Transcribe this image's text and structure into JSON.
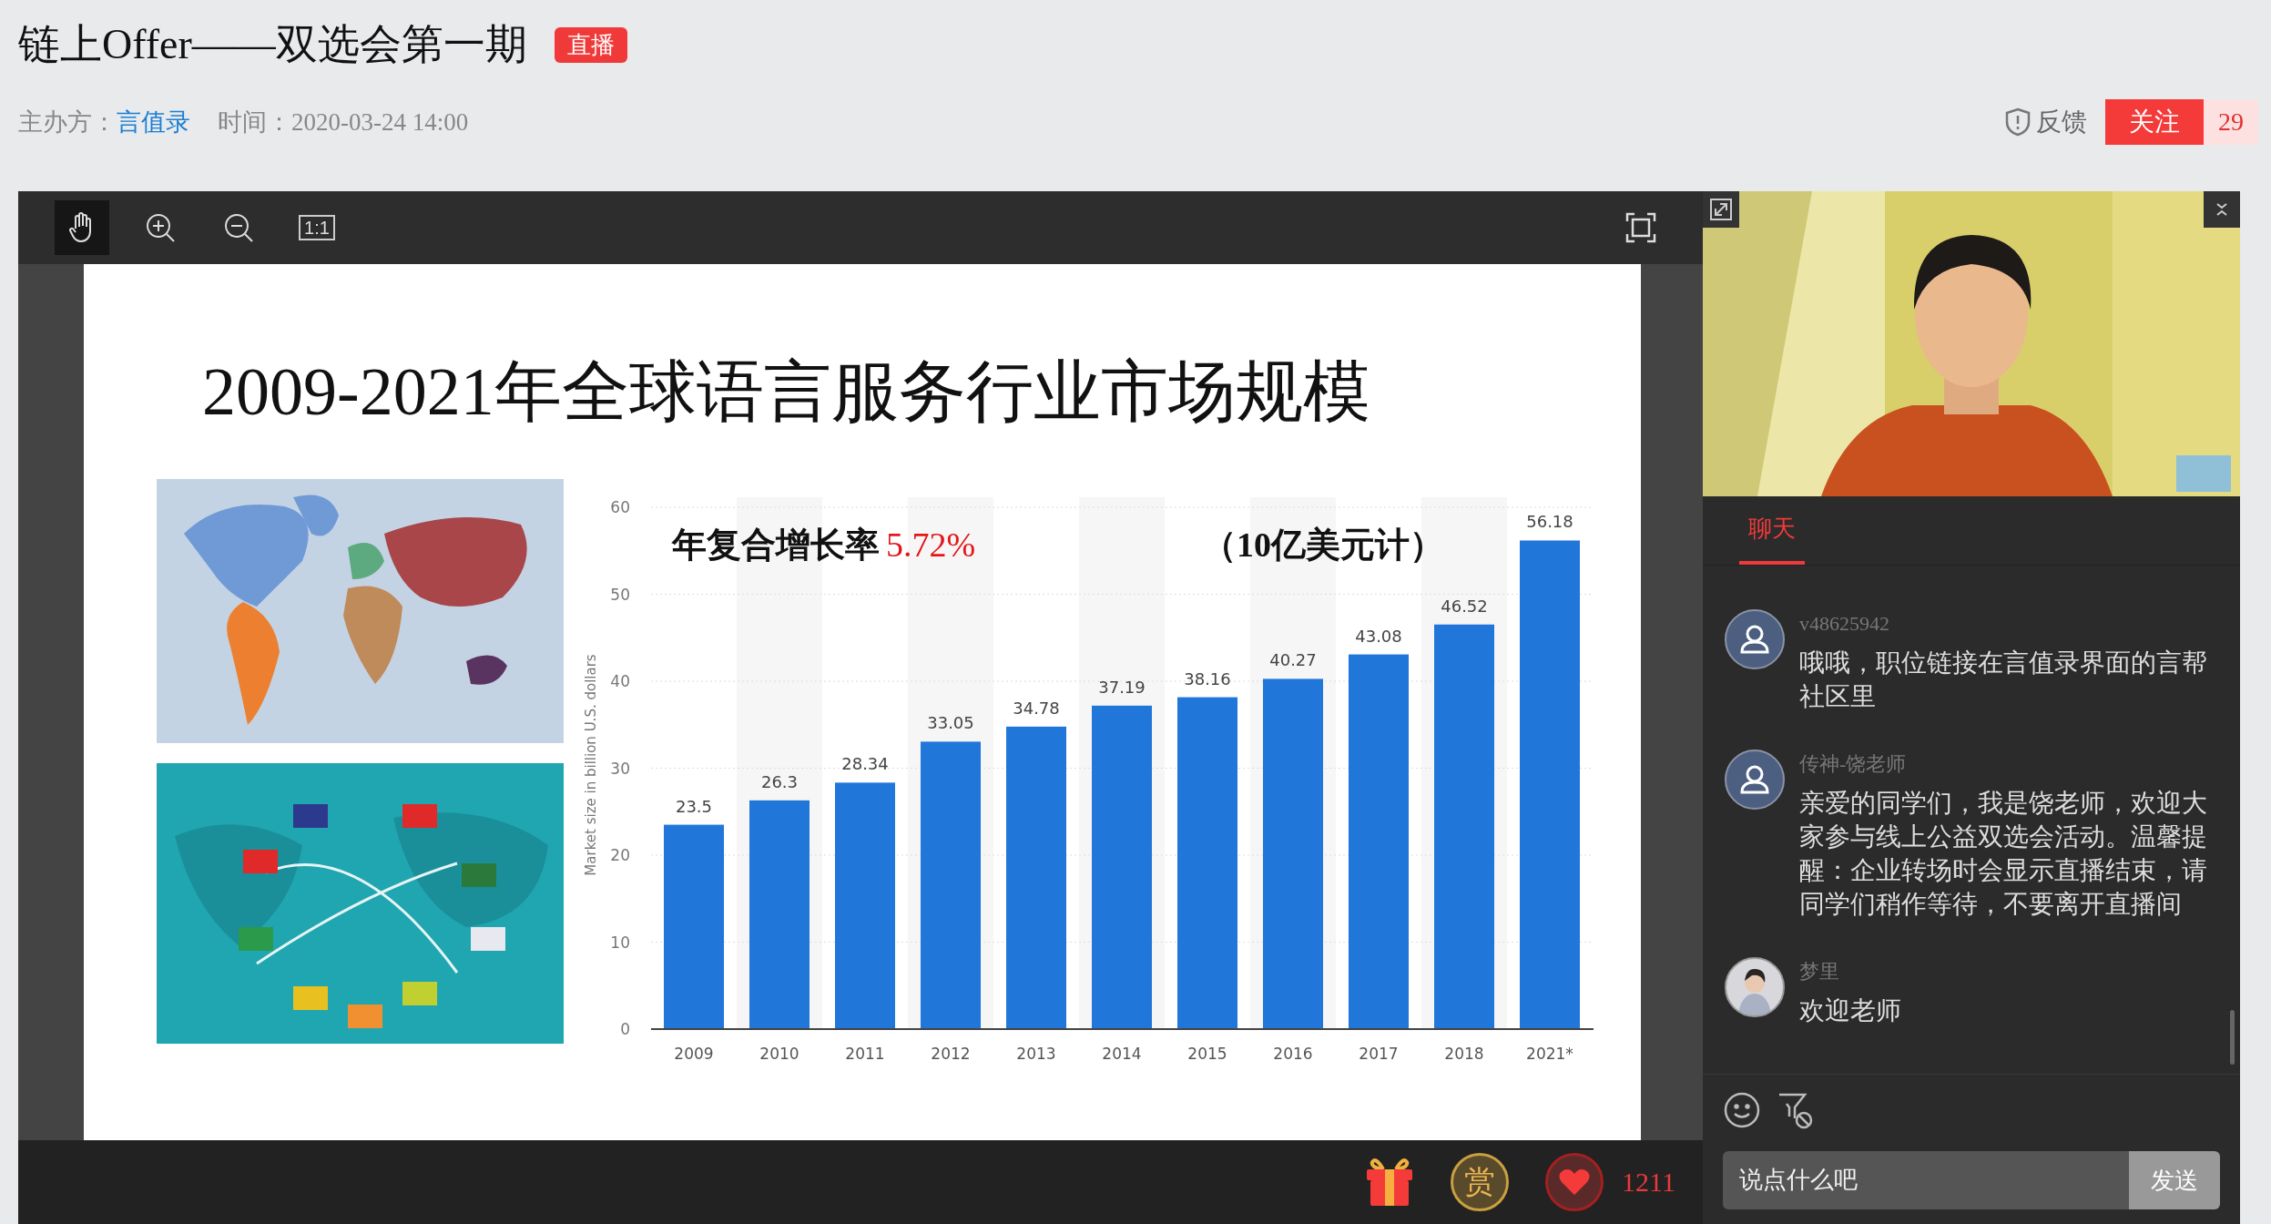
{
  "header": {
    "title": "链上Offer——双选会第一期",
    "live_badge": "直播",
    "host_label": "主办方：",
    "host_name": "言值录",
    "time": "时间：2020-03-24 14:00",
    "feedback": "反馈",
    "follow_button": "关注",
    "follower_count": "29"
  },
  "toolbar": {
    "tools": [
      {
        "kind": "hand",
        "selected": true
      },
      {
        "kind": "zoom-in",
        "selected": false
      },
      {
        "kind": "zoom-out",
        "selected": false
      },
      {
        "kind": "actual-size",
        "label": "1:1",
        "selected": false
      }
    ]
  },
  "slide": {
    "title": "2009-2021年全球语言服务行业市场规模",
    "growth_label": "年复合增长率",
    "growth_value": "5.72%",
    "unit_note": "（10亿美元计）",
    "chart_data": {
      "type": "bar",
      "ylabel": "Market size in billion U.S. dollars",
      "categories": [
        "2009",
        "2010",
        "2011",
        "2012",
        "2013",
        "2014",
        "2015",
        "2016",
        "2017",
        "2018",
        "2021*"
      ],
      "values": [
        23.5,
        26.3,
        28.34,
        33.05,
        34.78,
        37.19,
        38.16,
        40.27,
        43.08,
        46.52,
        56.18
      ],
      "ylim": [
        0,
        60
      ],
      "yticks": [
        0,
        10,
        20,
        30,
        40,
        50,
        60
      ],
      "grid": true,
      "data_labels": true
    }
  },
  "bottom_bar": {
    "reward_label": "赏",
    "like_count": "1211"
  },
  "chat": {
    "tabs": [
      {
        "label": "聊天",
        "selected": true
      }
    ],
    "messages": [
      {
        "user": "v48625942",
        "kind": "default",
        "text": "哦哦，职位链接在言值录界面的言帮社区里"
      },
      {
        "user": "传神-饶老师",
        "kind": "default",
        "text": "亲爱的同学们，我是饶老师，欢迎大家参与线上公益双选会活动。温馨提醒：企业转场时会显示直播结束，请同学们稍作等待，不要离开直播间"
      },
      {
        "user": "梦里",
        "text": "欢迎老师"
      }
    ],
    "input": {
      "placeholder": "说点什么吧"
    },
    "send_button": "发送"
  }
}
